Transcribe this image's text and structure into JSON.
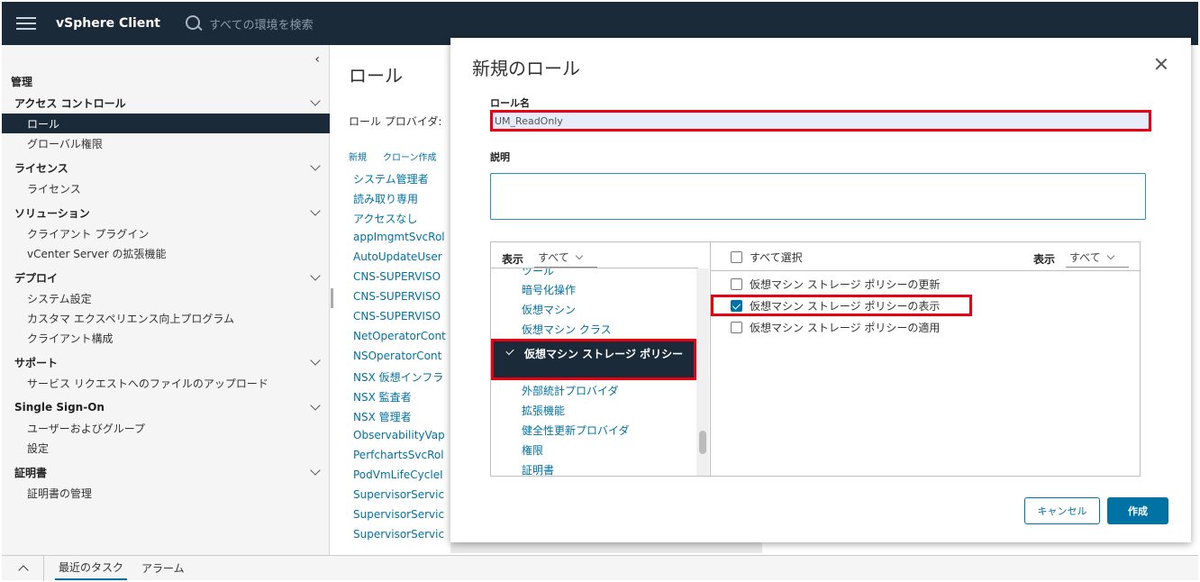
{
  "header": {
    "app_title": "vSphere Client",
    "search_placeholder": "すべての環境を検索",
    "bg_color": "#1b2a38"
  },
  "sidebar": {
    "section_title": "管理",
    "groups": [
      {
        "label": "アクセス コントロール",
        "items": [
          "ロール",
          "グローバル権限"
        ],
        "active_item": "ロール"
      },
      {
        "label": "ライセンス",
        "items": [
          "ライセンス"
        ]
      },
      {
        "label": "ソリューション",
        "items": [
          "クライアント プラグイン",
          "vCenter Server の拡張機能"
        ]
      },
      {
        "label": "デプロイ",
        "items": [
          "システム設定",
          "カスタマ エクスペリエンス向上プログラム",
          "クライアント構成"
        ]
      },
      {
        "label": "サポート",
        "items": [
          "サービス リクエストへのファイルのアップロード"
        ]
      },
      {
        "label": "Single Sign-On",
        "items": [
          "ユーザーおよびグループ",
          "設定"
        ]
      },
      {
        "label": "証明書",
        "items": [
          "証明書の管理"
        ]
      }
    ]
  },
  "main": {
    "title": "ロール",
    "provider_label": "ロール プロバイダ:",
    "actions": [
      "新規",
      "クローン作成"
    ],
    "roles": [
      "システム管理者",
      "読み取り専用",
      "アクセスなし",
      "appImgmtSvcRol",
      "AutoUpdateUser",
      "CNS-SUPERVISO",
      "CNS-SUPERVISO",
      "CNS-SUPERVISO",
      "NetOperatorCont",
      "NSOperatorCont",
      "NSX 仮想インフラ",
      "NSX 監査者",
      "NSX 管理者",
      "ObservabilityVap",
      "PerfchartsSvcRol",
      "PodVmLifeCycleI",
      "SupervisorServic",
      "SupervisorServic",
      "SupervisorServic"
    ]
  },
  "bottombar": {
    "tabs": [
      "最近のタスク",
      "アラーム"
    ],
    "active_tab": "最近のタスク"
  },
  "modal": {
    "title": "新規のロール",
    "role_name_label": "ロール名",
    "role_name_value": "UM_ReadOnly",
    "description_label": "説明",
    "description_value": "",
    "left_filter": {
      "label": "表示",
      "value": "すべて"
    },
    "categories": [
      {
        "label": "ツール",
        "state": "clipped"
      },
      {
        "label": "暗号化操作",
        "state": "normal"
      },
      {
        "label": "仮想マシン",
        "state": "normal"
      },
      {
        "label": "仮想マシン クラス",
        "state": "normal"
      },
      {
        "label": "仮想マシン ストレージ ポリシー",
        "state": "selected"
      },
      {
        "label": "外部統計プロバイダ",
        "state": "normal"
      },
      {
        "label": "拡張機能",
        "state": "normal"
      },
      {
        "label": "健全性更新プロバイダ",
        "state": "normal"
      },
      {
        "label": "権限",
        "state": "normal"
      },
      {
        "label": "証明書",
        "state": "normal"
      }
    ],
    "select_all_label": "すべて選択",
    "right_filter": {
      "label": "表示",
      "value": "すべて"
    },
    "privileges": [
      {
        "label": "仮想マシン ストレージ ポリシーの更新",
        "checked": false
      },
      {
        "label": "仮想マシン ストレージ ポリシーの表示",
        "checked": true
      },
      {
        "label": "仮想マシン ストレージ ポリシーの適用",
        "checked": false
      }
    ],
    "cancel_label": "キャンセル",
    "create_label": "作成",
    "accent_color": "#0072a3",
    "highlight_color": "#e60012"
  }
}
